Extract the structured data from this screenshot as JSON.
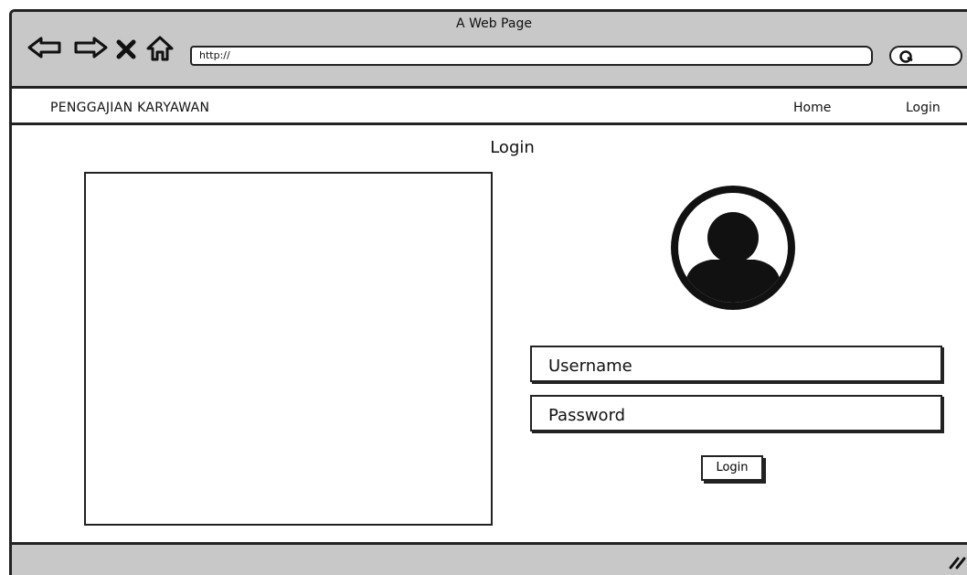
{
  "window": {
    "title": "A Web Page"
  },
  "browser": {
    "url": "http://",
    "icons": [
      "back-arrow-icon",
      "forward-arrow-icon",
      "close-icon",
      "home-icon",
      "search-icon"
    ]
  },
  "menu": {
    "brand": "PENGGAJIAN KARYAWAN",
    "items": [
      {
        "label": "Home"
      },
      {
        "label": "Login"
      }
    ]
  },
  "main": {
    "title": "Login",
    "form": {
      "username_placeholder": "Username",
      "password_placeholder": "Password",
      "submit_label": "Login"
    }
  }
}
